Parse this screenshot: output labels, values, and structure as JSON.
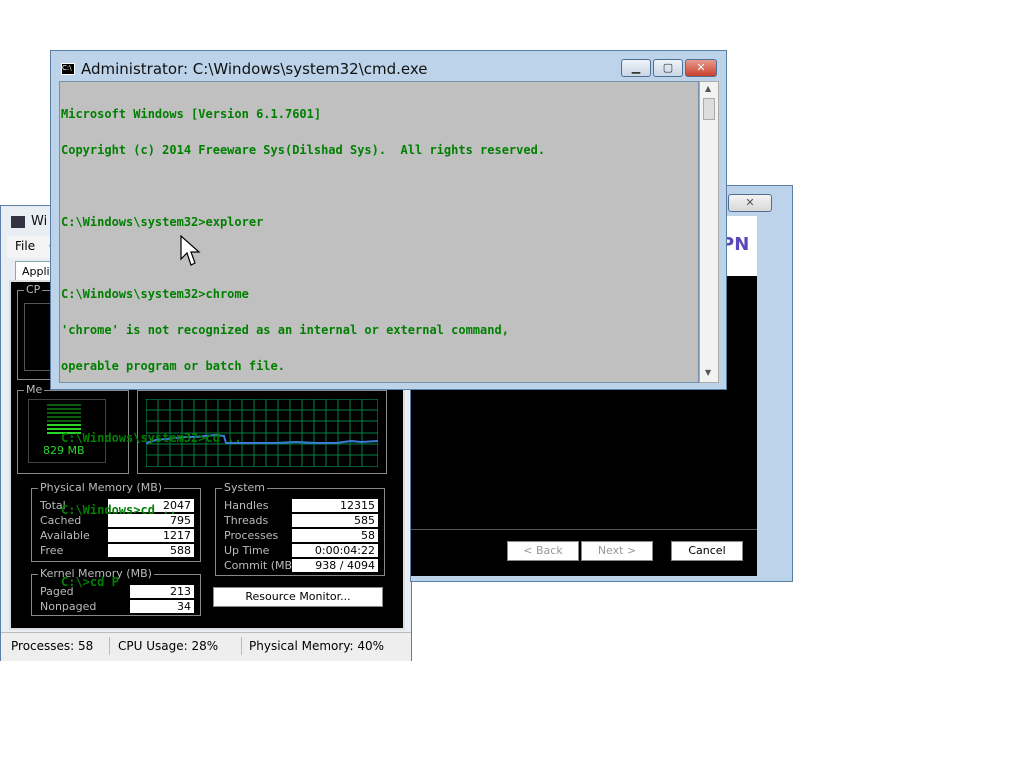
{
  "task_manager": {
    "title": "Wi",
    "menu": [
      "File",
      "O"
    ],
    "tab_label": "Applica",
    "cpu_label": "CP",
    "mem_label": "Me",
    "mem_value": "829 MB",
    "physical": {
      "label": "Physical Memory (MB)",
      "rows": [
        {
          "name": "Total",
          "value": "2047"
        },
        {
          "name": "Cached",
          "value": "795"
        },
        {
          "name": "Available",
          "value": "1217"
        },
        {
          "name": "Free",
          "value": "588"
        }
      ]
    },
    "kernel": {
      "label": "Kernel Memory (MB)",
      "rows": [
        {
          "name": "Paged",
          "value": "213"
        },
        {
          "name": "Nonpaged",
          "value": "34"
        }
      ]
    },
    "system": {
      "label": "System",
      "rows": [
        {
          "name": "Handles",
          "value": "12315"
        },
        {
          "name": "Threads",
          "value": "585"
        },
        {
          "name": "Processes",
          "value": "58"
        },
        {
          "name": "Up Time",
          "value": "0:00:04:22"
        },
        {
          "name": "Commit (MB)",
          "value": "938 / 4094"
        }
      ]
    },
    "resource_monitor_label": "Resource Monitor...",
    "status": {
      "processes": "Processes: 58",
      "cpu": "CPU Usage: 28%",
      "memory": "Physical Memory: 40%"
    }
  },
  "wizard": {
    "logo_fragment": "PN",
    "back_label": "< Back",
    "next_label": "Next >",
    "cancel_label": "Cancel"
  },
  "cmd": {
    "title": "Administrator: C:\\Windows\\system32\\cmd.exe",
    "lines": [
      "Microsoft Windows [Version 6.1.7601]",
      "Copyright (c) 2014 Freeware Sys(Dilshad Sys).  All rights reserved.",
      "",
      "C:\\Windows\\system32>explorer",
      "",
      "C:\\Windows\\system32>chrome",
      "'chrome' is not recognized as an internal or external command,",
      "operable program or batch file.",
      "",
      "C:\\Windows\\system32>cd ..",
      "",
      "C:\\Windows>cd ..",
      "",
      "C:\\>cd P"
    ]
  },
  "colors": {
    "console_bg": "#c0c0c0",
    "console_text": "#008000",
    "graph_line": "#3a7bd5",
    "graph_grid": "#008040"
  }
}
